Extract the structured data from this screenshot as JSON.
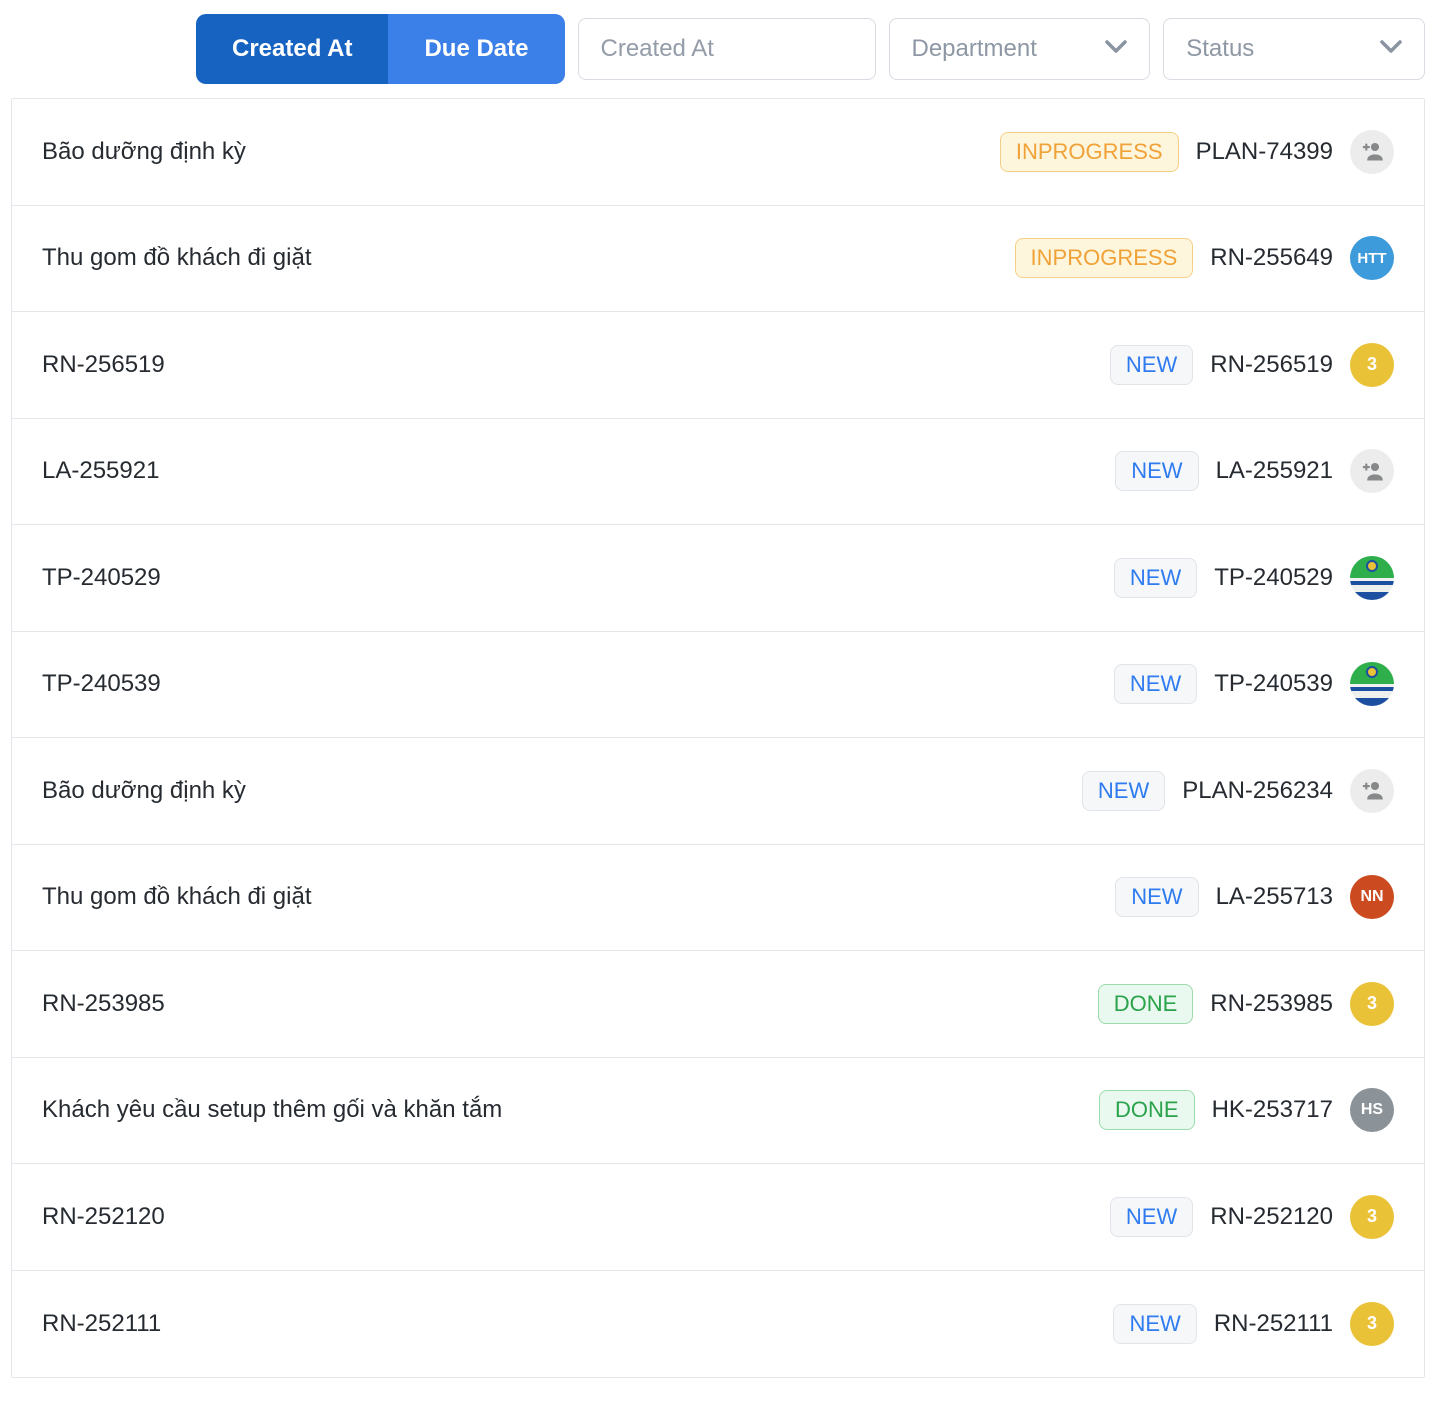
{
  "toolbar": {
    "created_at_button": "Created At",
    "due_date_button": "Due Date",
    "search_placeholder": "Created At",
    "department_label": "Department",
    "status_label": "Status"
  },
  "colors": {
    "toggle_active": "#1763c2",
    "toggle_inactive": "#3b7fe8",
    "status_inprogress": "#f0a238",
    "status_new": "#2f7bf0",
    "status_done": "#2ba24c",
    "avatar_yellow": "#e9c237",
    "avatar_blue": "#3d9adb",
    "avatar_red": "#cc4a1f",
    "avatar_gray": "#8b9399"
  },
  "rows": [
    {
      "title": "Bão dưỡng định kỳ",
      "status": "INPROGRESS",
      "variant": "inprogress",
      "code": "PLAN-74399",
      "avatar": {
        "type": "add-person",
        "icon": "person-add-icon"
      }
    },
    {
      "title": "Thu gom đồ khách đi giặt",
      "status": "INPROGRESS",
      "variant": "inprogress",
      "code": "RN-255649",
      "avatar": {
        "type": "initials",
        "text": "HTT",
        "color": "#3d9adb"
      }
    },
    {
      "title": "RN-256519",
      "status": "NEW",
      "variant": "new",
      "code": "RN-256519",
      "avatar": {
        "type": "initials",
        "text": "3",
        "color": "#e9c237"
      }
    },
    {
      "title": "LA-255921",
      "status": "NEW",
      "variant": "new",
      "code": "LA-255921",
      "avatar": {
        "type": "add-person",
        "icon": "person-add-icon"
      }
    },
    {
      "title": "TP-240529",
      "status": "NEW",
      "variant": "new",
      "code": "TP-240529",
      "avatar": {
        "type": "logo",
        "icon": "org-logo"
      }
    },
    {
      "title": "TP-240539",
      "status": "NEW",
      "variant": "new",
      "code": "TP-240539",
      "avatar": {
        "type": "logo",
        "icon": "org-logo"
      }
    },
    {
      "title": "Bão dưỡng định kỳ",
      "status": "NEW",
      "variant": "new",
      "code": "PLAN-256234",
      "avatar": {
        "type": "add-person",
        "icon": "person-add-icon"
      }
    },
    {
      "title": "Thu gom đồ khách đi giặt",
      "status": "NEW",
      "variant": "new",
      "code": "LA-255713",
      "avatar": {
        "type": "initials",
        "text": "NN",
        "color": "#cc4a1f"
      }
    },
    {
      "title": "RN-253985",
      "status": "DONE",
      "variant": "done",
      "code": "RN-253985",
      "avatar": {
        "type": "initials",
        "text": "3",
        "color": "#e9c237"
      }
    },
    {
      "title": "Khách yêu cầu setup thêm gối và khăn tắm",
      "status": "DONE",
      "variant": "done",
      "code": "HK-253717",
      "avatar": {
        "type": "initials",
        "text": "HS",
        "color": "#8b9399"
      }
    },
    {
      "title": "RN-252120",
      "status": "NEW",
      "variant": "new",
      "code": "RN-252120",
      "avatar": {
        "type": "initials",
        "text": "3",
        "color": "#e9c237"
      }
    },
    {
      "title": "RN-252111",
      "status": "NEW",
      "variant": "new",
      "code": "RN-252111",
      "avatar": {
        "type": "initials",
        "text": "3",
        "color": "#e9c237"
      }
    }
  ]
}
